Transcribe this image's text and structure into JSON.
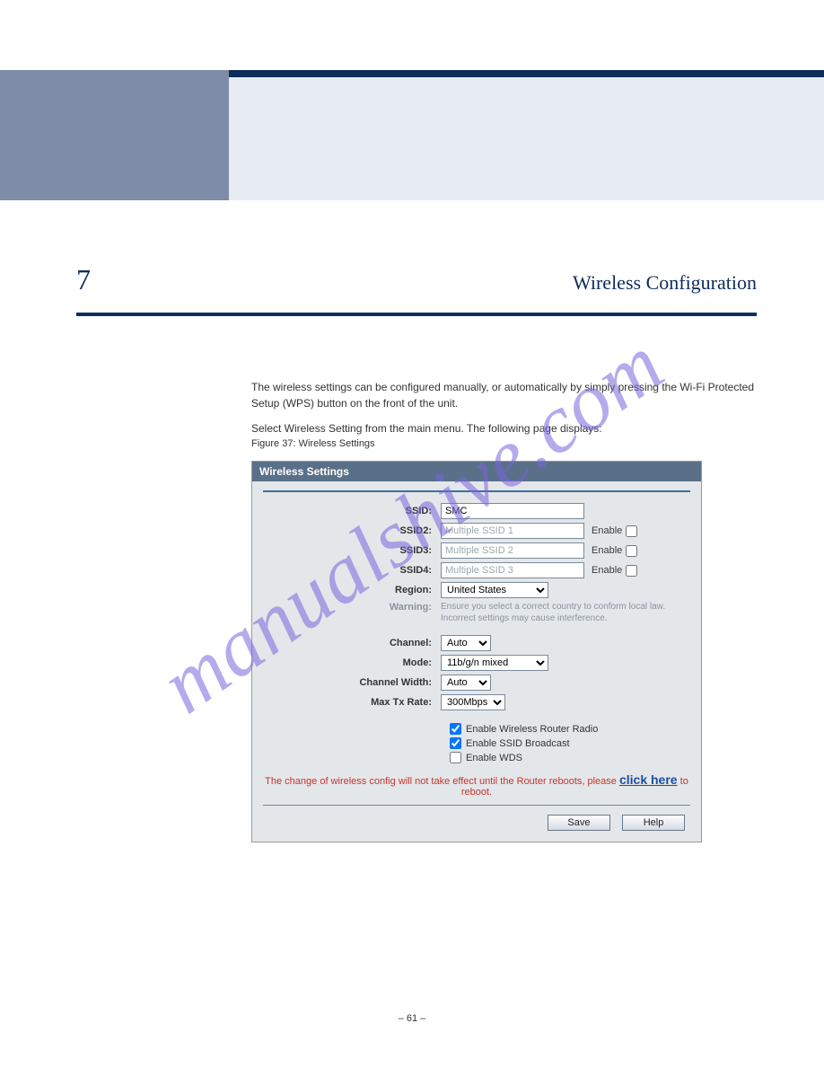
{
  "watermark": "manualshive.com",
  "chapter": {
    "number": "7",
    "title": "Wireless Configuration"
  },
  "intro": {
    "para1": "The wireless settings can be configured manually, or automatically by simply pressing the Wi-Fi Protected Setup (WPS) button on the front of the unit.",
    "para2": "Select Wireless Setting from the main menu. The following page displays:"
  },
  "figure_caption": "Figure 37: Wireless Settings",
  "panel": {
    "title": "Wireless Settings",
    "fields": {
      "ssid_label": "SSID:",
      "ssid_value": "SMC",
      "ssid2_label": "SSID2:",
      "ssid2_value": "Multiple SSID 1",
      "ssid3_label": "SSID3:",
      "ssid3_value": "Multiple SSID 2",
      "ssid4_label": "SSID4:",
      "ssid4_value": "Multiple SSID 3",
      "enable_label": "Enable",
      "region_label": "Region:",
      "region_value": "United States",
      "warning_label": "Warning:",
      "warning_text": "Ensure you select a correct country to conform local law. Incorrect settings may cause interference.",
      "channel_label": "Channel:",
      "channel_value": "Auto",
      "mode_label": "Mode:",
      "mode_value": "11b/g/n mixed",
      "chwidth_label": "Channel Width:",
      "chwidth_value": "Auto",
      "maxtx_label": "Max Tx Rate:",
      "maxtx_value": "300Mbps",
      "opt_radio": "Enable Wireless Router Radio",
      "opt_ssidbc": "Enable SSID Broadcast",
      "opt_wds": "Enable WDS"
    },
    "reboot": {
      "pre": "The change of wireless config will not take effect until the Router reboots, please ",
      "link": "click here",
      "post": " to reboot."
    },
    "buttons": {
      "save": "Save",
      "help": "Help"
    }
  },
  "footer": "– 61 –"
}
